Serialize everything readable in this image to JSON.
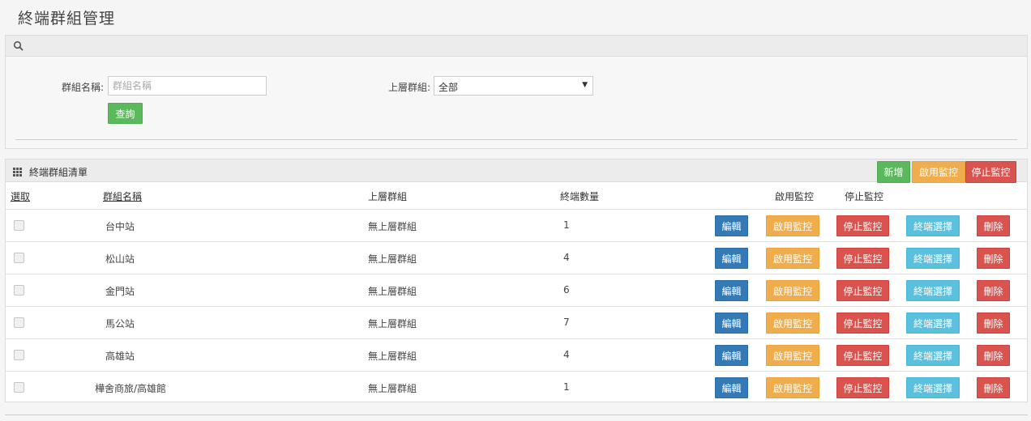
{
  "page": {
    "title": "終端群組管理"
  },
  "search": {
    "group_name_label": "群組名稱:",
    "group_name_value": "",
    "group_name_placeholder": "群組名稱",
    "parent_group_label": "上層群組:",
    "parent_group_selected": "全部",
    "query_button": "查詢"
  },
  "list": {
    "title": "終端群組清單",
    "add_button": "新增",
    "enable_monitor_button": "啟用監控",
    "stop_monitor_button": "停止監控",
    "columns": {
      "select": "選取",
      "group_name": "群組名稱",
      "parent_group": "上層群組",
      "terminal_count": "終端數量",
      "enable_monitor": "啟用監控",
      "stop_monitor": "停止監控"
    },
    "row_actions": {
      "edit": "編輯",
      "enable_monitor": "啟用監控",
      "stop_monitor": "停止監控",
      "select_terminal": "終端選擇",
      "delete": "刪除"
    },
    "rows": [
      {
        "name": "台中站",
        "parent": "無上層群組",
        "count": "1"
      },
      {
        "name": "松山站",
        "parent": "無上層群組",
        "count": "4"
      },
      {
        "name": "金門站",
        "parent": "無上層群組",
        "count": "6"
      },
      {
        "name": "馬公站",
        "parent": "無上層群組",
        "count": "7"
      },
      {
        "name": "高雄站",
        "parent": "無上層群組",
        "count": "4"
      },
      {
        "name": "樺舍商旅/高雄館",
        "parent": "無上層群組",
        "count": "1"
      }
    ]
  },
  "colors": {
    "green": "#5cb85c",
    "orange": "#f0ad4e",
    "red": "#d9534f",
    "blue": "#337ab7",
    "cyan": "#5bc0de"
  }
}
